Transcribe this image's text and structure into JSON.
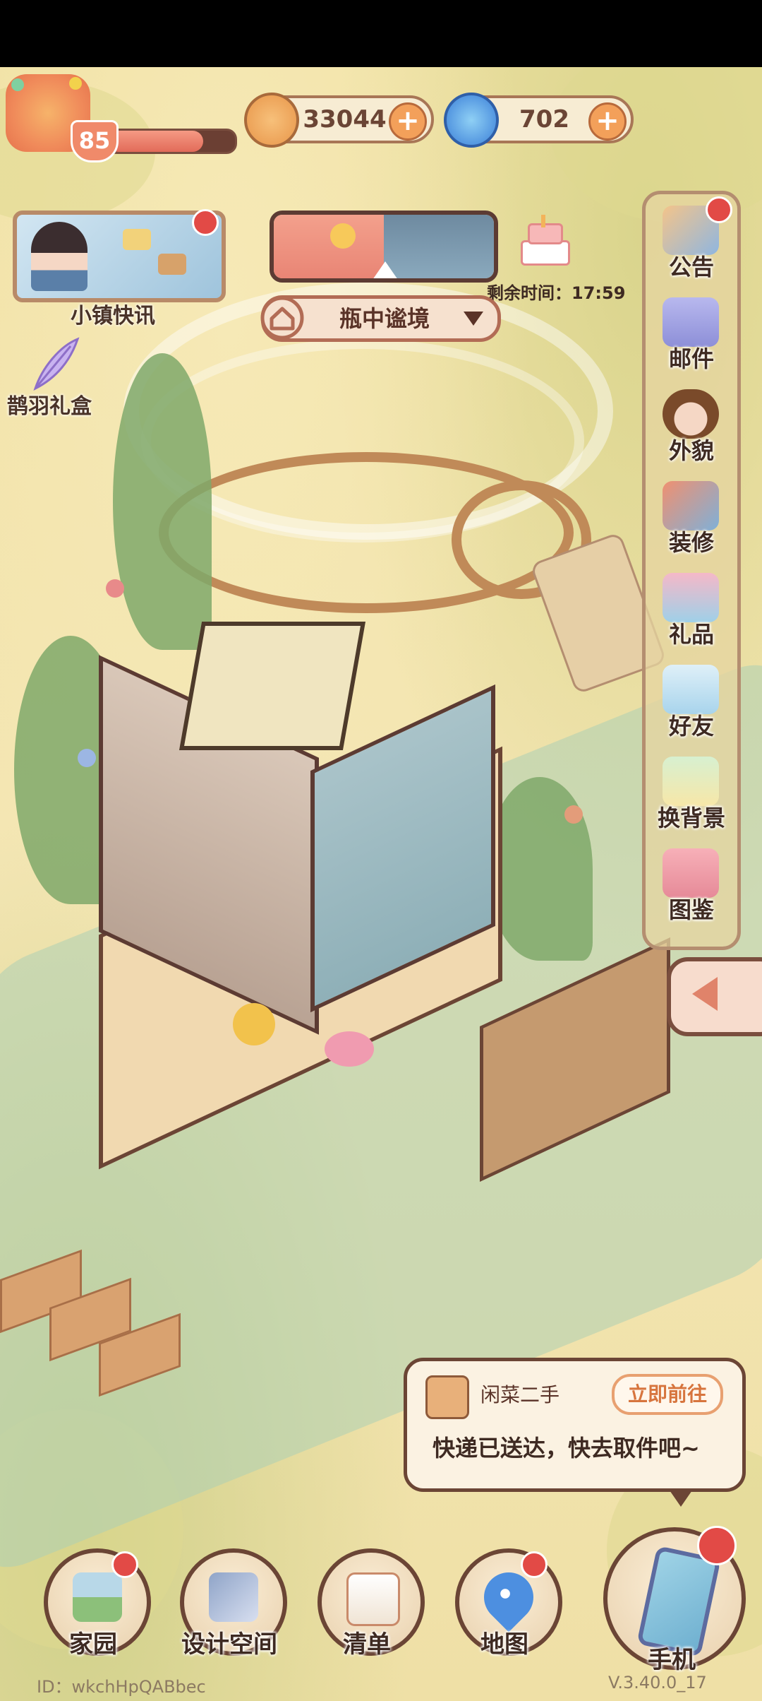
{
  "hud": {
    "level": "85",
    "xp_progress": 0.75,
    "coins": "33044",
    "gems": "702",
    "plus_symbol": "+"
  },
  "left_panel": {
    "news_label": "小镇快讯",
    "gift_label": "鹊羽礼盒"
  },
  "top_center": {
    "location_name": "瓶中谧境",
    "timer_text": "剩余时间：17:59"
  },
  "right_menu": [
    {
      "label": "公告",
      "icon": "announcement-icon",
      "badge": true
    },
    {
      "label": "邮件",
      "icon": "mail-icon",
      "badge": false
    },
    {
      "label": "外貌",
      "icon": "appearance-icon",
      "badge": false
    },
    {
      "label": "装修",
      "icon": "decorate-icon",
      "badge": false
    },
    {
      "label": "礼品",
      "icon": "gift-icon",
      "badge": false
    },
    {
      "label": "好友",
      "icon": "friends-icon",
      "badge": false
    },
    {
      "label": "换背景",
      "icon": "background-icon",
      "badge": false
    },
    {
      "label": "图鉴",
      "icon": "album-icon",
      "badge": false
    }
  ],
  "notification": {
    "sender": "闲菜二手",
    "action": "立即前往",
    "message": "快递已送达，快去取件吧~"
  },
  "bottom_nav": [
    {
      "label": "家园",
      "icon": "home-icon",
      "badge": true
    },
    {
      "label": "设计空间",
      "icon": "design-icon",
      "badge": false
    },
    {
      "label": "清单",
      "icon": "list-icon",
      "badge": false
    },
    {
      "label": "地图",
      "icon": "map-icon",
      "badge": true
    },
    {
      "label": "手机",
      "icon": "phone-icon",
      "badge": true
    }
  ],
  "footer": {
    "id_text": "ID：wkchHpQABbec",
    "version": "V.3.40.0_17"
  },
  "colors": {
    "accent_orange": "#f3a05a",
    "badge_red": "#e24a46",
    "frame_brown": "#6b4535"
  }
}
